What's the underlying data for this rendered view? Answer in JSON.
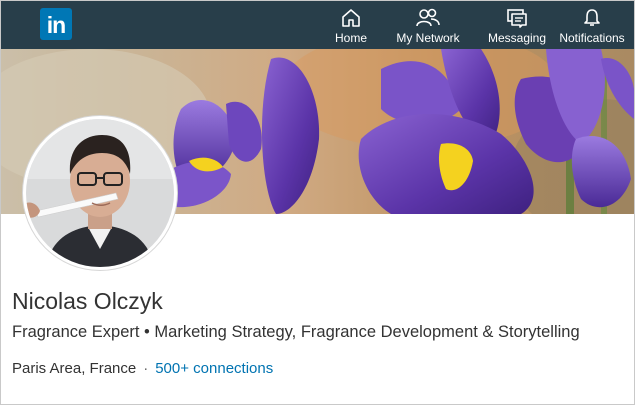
{
  "nav": {
    "logo_text": "in",
    "items": [
      {
        "label": "Home",
        "icon": "home-icon"
      },
      {
        "label": "My Network",
        "icon": "network-icon"
      },
      {
        "label": "Messaging",
        "icon": "messaging-icon"
      },
      {
        "label": "Notifications",
        "icon": "bell-icon"
      }
    ]
  },
  "profile": {
    "name": "Nicolas Olczyk",
    "headline": "Fragrance Expert • Marketing Strategy, Fragrance Development & Storytelling",
    "location": "Paris Area, France",
    "separator": "·",
    "connections": "500+ connections"
  },
  "colors": {
    "nav_bg": "#283e4a",
    "brand": "#0077b5",
    "link": "#0073b1",
    "iris_purple": "#6a3fb2",
    "iris_yellow": "#f4d21f"
  }
}
